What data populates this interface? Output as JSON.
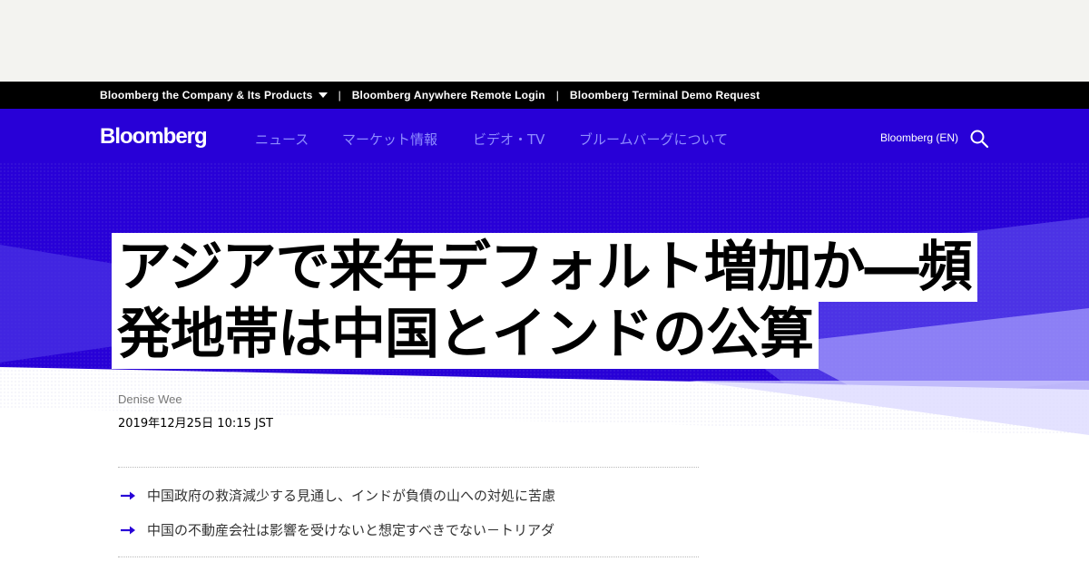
{
  "corp_bar": {
    "company": "Bloomberg the Company & Its Products",
    "remote_login": "Bloomberg Anywhere Remote Login",
    "demo_request": "Bloomberg Terminal Demo Request"
  },
  "nav": {
    "logo": "Bloomberg",
    "items": [
      "ニュース",
      "マーケット情報",
      "ビデオ・TV",
      "ブルームバーグについて"
    ],
    "edition": "Bloomberg (EN)"
  },
  "article": {
    "headline": "アジアで来年デフォルト増加か―頻発地帯は中国とインドの公算",
    "author": "Denise Wee",
    "date": "2019年12月25日 10:15 JST",
    "bullets": [
      "中国政府の救済減少する見通し、インドが負債の山への対処に苦慮",
      "中国の不動産会社は影響を受けないと想定すべきでない－トリアダ"
    ]
  },
  "colors": {
    "brand_blue": "#2800d7",
    "nav_link": "#8f8cff",
    "arrow": "#2800d7"
  }
}
